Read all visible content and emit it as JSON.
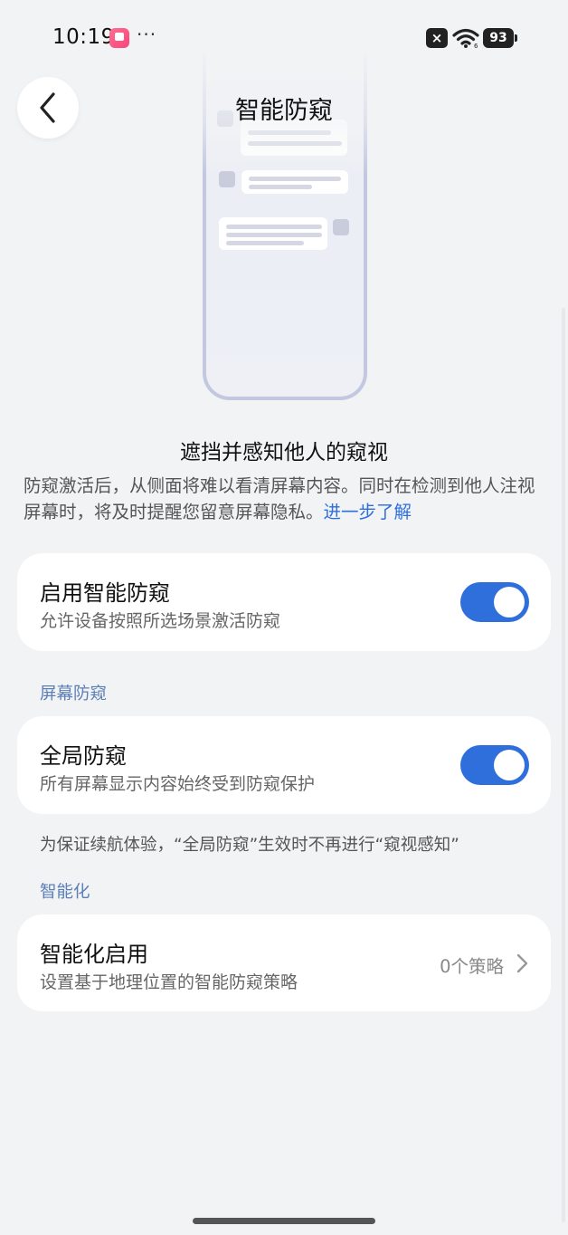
{
  "status": {
    "time": "10:19",
    "more": "···",
    "sim": "×",
    "battery": "93"
  },
  "header": {
    "title": "智能防窥"
  },
  "intro": {
    "heading": "遮挡并感知他人的窥视",
    "description": "防窥激活后，从侧面将难以看清屏幕内容。同时在检测到他人注视屏幕时，将及时提醒您留意屏幕隐私。",
    "learn_more": "进一步了解"
  },
  "enable_card": {
    "title": "启用智能防窥",
    "subtitle": "允许设备按照所选场景激活防窥",
    "toggle_on": true
  },
  "screen_section": {
    "label": "屏幕防窥",
    "global_title": "全局防窥",
    "global_subtitle": "所有屏幕显示内容始终受到防窥保护",
    "toggle_on": true,
    "note": "为保证续航体验，“全局防窥”生效时不再进行“窥视感知”"
  },
  "smart_section": {
    "label": "智能化",
    "title": "智能化启用",
    "subtitle": "设置基于地理位置的智能防窥策略",
    "value": "0个策略"
  },
  "colors": {
    "accent": "#2f6fdc",
    "background": "#f1f3f5",
    "section_label": "#5d7fb8"
  }
}
